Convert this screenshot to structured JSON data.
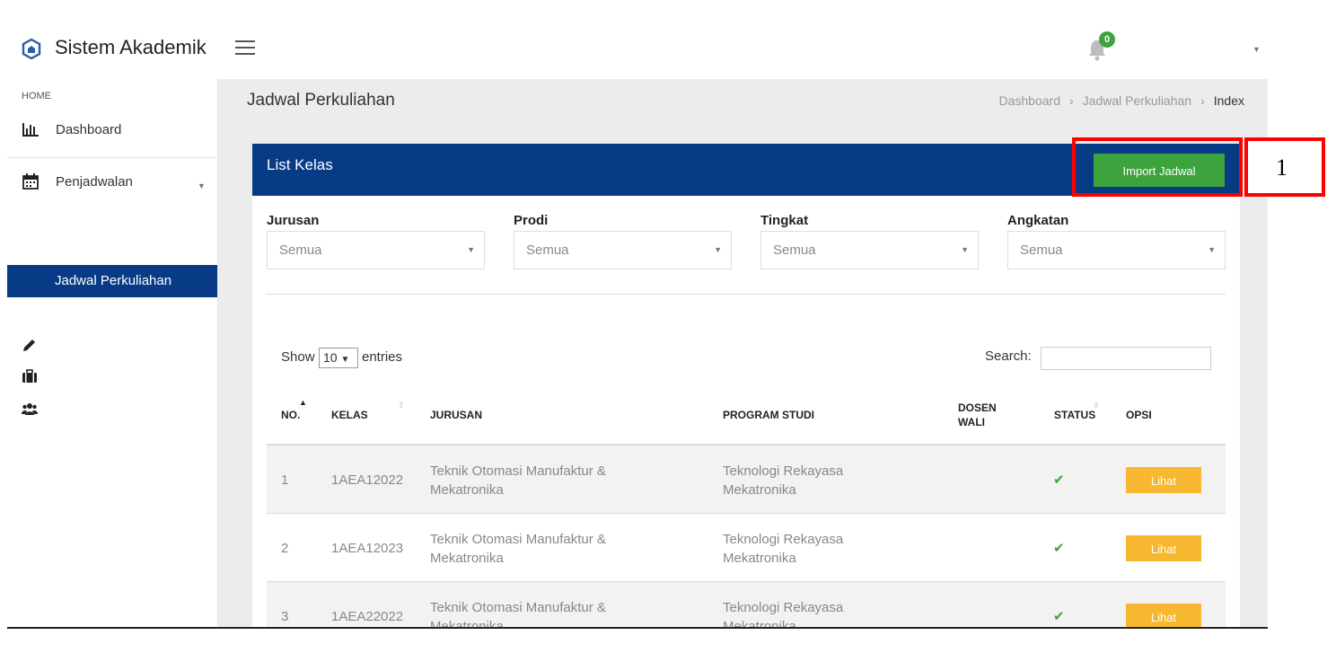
{
  "app": {
    "title": "Sistem Akademik",
    "logo_icon": "home-logo-icon"
  },
  "header": {
    "notification_count": "0"
  },
  "sidebar": {
    "section_label": "HOME",
    "items": [
      {
        "label": "Dashboard",
        "icon": "bar-chart-icon"
      },
      {
        "label": "Penjadwalan",
        "icon": "calendar-icon"
      },
      {
        "label": "Jadwal Perkuliahan",
        "icon": ""
      }
    ],
    "extra_icons": [
      "pencil-icon",
      "briefcase-icon",
      "users-icon"
    ]
  },
  "page": {
    "title": "Jadwal Perkuliahan",
    "breadcrumb": [
      "Dashboard",
      "Jadwal Perkuliahan",
      "Index"
    ]
  },
  "card": {
    "title": "List Kelas",
    "import_button": "Import Jadwal",
    "filters": [
      {
        "label": "Jurusan",
        "value": "Semua"
      },
      {
        "label": "Prodi",
        "value": "Semua"
      },
      {
        "label": "Tingkat",
        "value": "Semua"
      },
      {
        "label": "Angkatan",
        "value": "Semua"
      }
    ]
  },
  "table": {
    "show_label": "Show",
    "page_size": "10",
    "entries_label": "entries",
    "search_label": "Search:",
    "columns": [
      "NO.",
      "KELAS",
      "JURUSAN",
      "PROGRAM STUDI",
      "DOSEN WALI",
      "STATUS",
      "OPSI"
    ],
    "rows": [
      {
        "no": "1",
        "kelas": "1AEA12022",
        "jurusan": "Teknik Otomasi Manufaktur & Mekatronika",
        "prodi": "Teknologi Rekayasa Mekatronika",
        "dosen": "",
        "status": "active",
        "opsi": "Lihat"
      },
      {
        "no": "2",
        "kelas": "1AEA12023",
        "jurusan": "Teknik Otomasi Manufaktur & Mekatronika",
        "prodi": "Teknologi Rekayasa Mekatronika",
        "dosen": "",
        "status": "active",
        "opsi": "Lihat"
      },
      {
        "no": "3",
        "kelas": "1AEA22022",
        "jurusan": "Teknik Otomasi Manufaktur & Mekatronika",
        "prodi": "Teknologi Rekayasa Mekatronika",
        "dosen": "",
        "status": "active",
        "opsi": "Lihat"
      }
    ]
  },
  "annotation": {
    "number": "1"
  },
  "colors": {
    "primary": "#073b86",
    "success": "#3da33d",
    "warning": "#f7b731",
    "highlight": "#ff0000"
  }
}
